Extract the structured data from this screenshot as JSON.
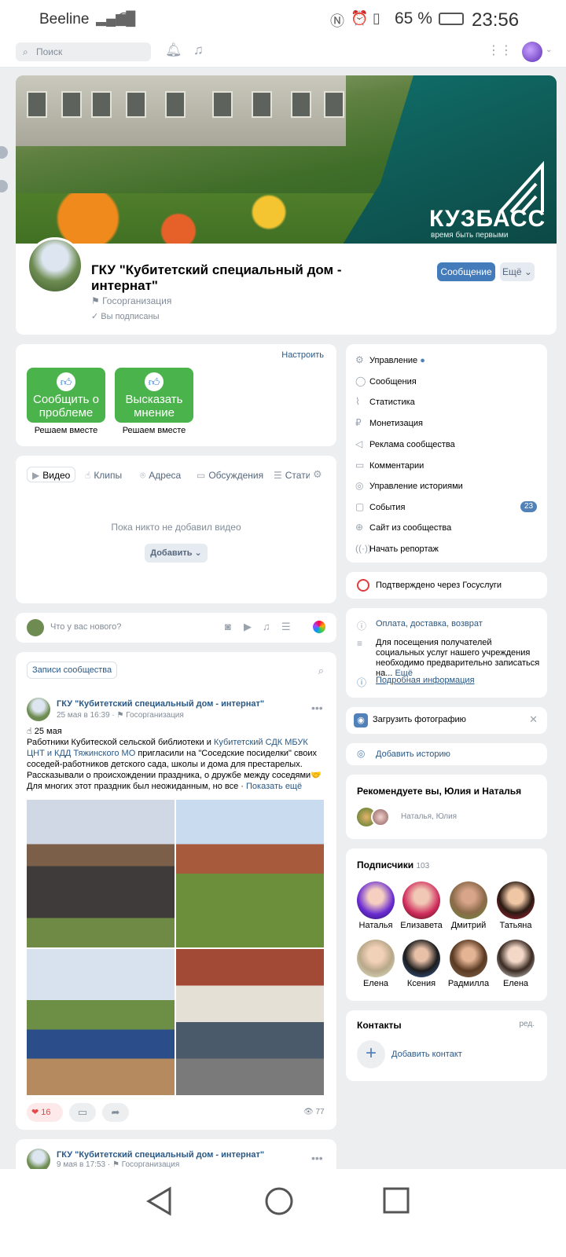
{
  "status": {
    "carrier": "Beeline",
    "battery": "65 %",
    "time": "23:56"
  },
  "topbar": {
    "search_placeholder": "Поиск"
  },
  "cover": {
    "brand": "КУЗБАСС",
    "slogan": "время быть первыми"
  },
  "profile": {
    "name": "ГКУ \"Кубитетский специальный дом - интернат\"",
    "type": "Госорганизация",
    "subscribed": "Вы подписаны",
    "message_btn": "Сообщение",
    "more_btn": "Ещё"
  },
  "widgets": {
    "configure": "Настроить",
    "tiles": [
      {
        "label": "Сообщить о проблеме",
        "caption": "Решаем вместе"
      },
      {
        "label": "Высказать мнение",
        "caption": "Решаем вместе"
      }
    ]
  },
  "media": {
    "tabs": [
      "Видео",
      "Клипы",
      "Адреса",
      "Обсуждения",
      "Стати"
    ],
    "empty": "Пока никто не добавил видео",
    "add_btn": "Добавить"
  },
  "composer": {
    "placeholder": "Что у вас нового?"
  },
  "wall": {
    "title": "Записи сообщества"
  },
  "post": {
    "author": "ГКУ \"Кубитетский специальный дом - интернат\"",
    "date": "25 мая в 16:39",
    "type": "Госорганизация",
    "line1": "☝ 25 мая",
    "line2a": "Работники Кубитеской сельской библиотеки и ",
    "line2link": "Кубитетский СДК МБУК ЦНТ и КДД Тяжинского МО",
    "line2b": " пригласили на \"Соседские посиделки\" своих соседей-работников детского сада, школы и дома для престарелых.",
    "line3": "Рассказывали о происхождении праздника, о дружбе между соседями🤝",
    "line4": "Для многих этот праздник был неожиданным, но все",
    "show_more": "Показать ещё",
    "likes": "16",
    "views": "77"
  },
  "post2": {
    "author": "ГКУ \"Кубитетский специальный дом - интернат\"",
    "date": "9 мая в 17:53",
    "type": "Госорганизация"
  },
  "menu": {
    "items": [
      {
        "label": "Управление",
        "icon": "gear-icon"
      },
      {
        "label": "Сообщения",
        "icon": "chat-icon"
      },
      {
        "label": "Статистика",
        "icon": "chart-icon"
      },
      {
        "label": "Монетизация",
        "icon": "ruble-icon"
      },
      {
        "label": "Реклама сообщества",
        "icon": "megaphone-icon"
      },
      {
        "label": "Комментарии",
        "icon": "comment-icon"
      },
      {
        "label": "Управление историями",
        "icon": "stories-icon"
      },
      {
        "label": "События",
        "icon": "calendar-icon"
      },
      {
        "label": "Сайт из сообщества",
        "icon": "globe-icon"
      },
      {
        "label": "Начать репортаж",
        "icon": "broadcast-icon"
      }
    ],
    "events_badge": "23"
  },
  "gosuslugi": {
    "text": "Подтверждено через Госуслуги"
  },
  "info": {
    "payment": "Оплата, доставка, возврат",
    "desc": "Для посещения получателей социальных услуг нашего учреждения необходимо предварительно записаться на...",
    "desc_more": "Ещё",
    "details": "Подробная информация"
  },
  "upload": {
    "text": "Загрузить фотографию"
  },
  "story": {
    "text": "Добавить историю"
  },
  "recommend": {
    "title": "Рекомендуете вы, Юлия и Наталья",
    "names": "Наталья, Юлия"
  },
  "subscribers": {
    "title": "Подписчики",
    "count": "103",
    "people": [
      "Наталья",
      "Елизавета",
      "Дмитрий",
      "Татьяна",
      "Елена",
      "Ксения",
      "Радмилла",
      "Елена"
    ]
  },
  "contacts": {
    "title": "Контакты",
    "edit": "ред.",
    "add": "Добавить контакт"
  },
  "colors": {
    "accent": "#447bba",
    "link": "#2a5885",
    "tile": "#4bb34b"
  }
}
